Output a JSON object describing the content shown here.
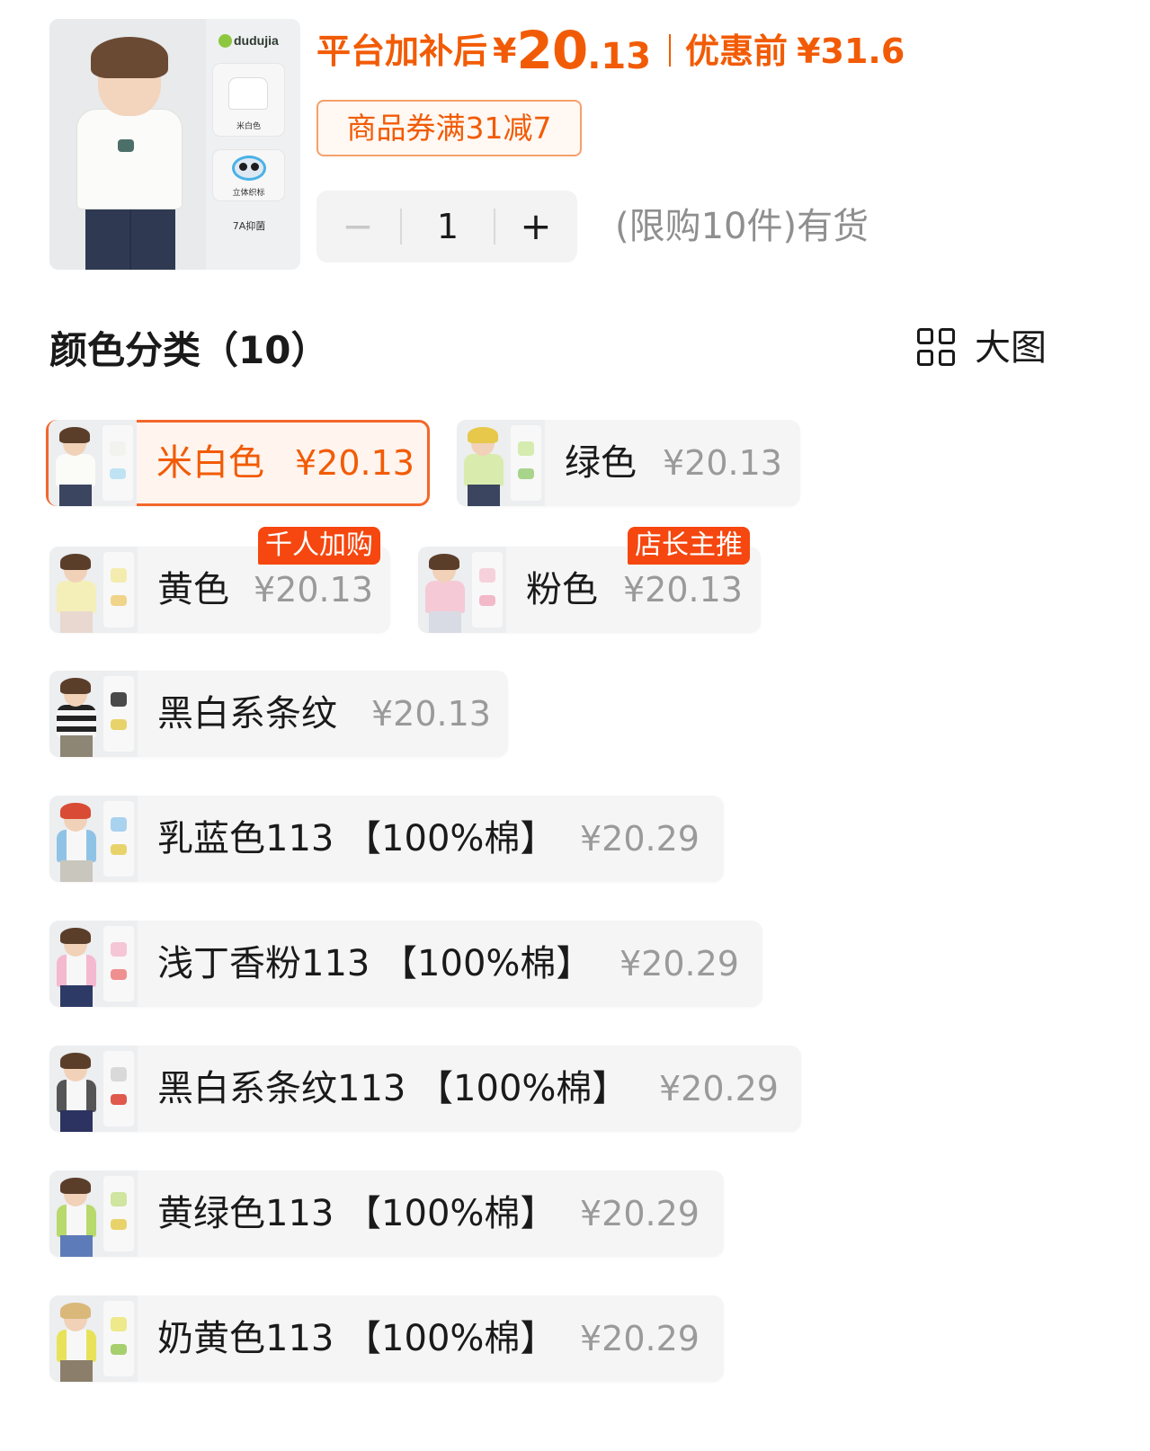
{
  "header": {
    "hero_brand": "dudujia",
    "hero_tile1_caption": "米白色",
    "hero_tile2_caption": "立体织标",
    "hero_tile3_caption": "7A抑菌",
    "price_label": "平台加补后",
    "price_yen": "¥",
    "price_int": "20",
    "price_dec": ".13",
    "orig_label": "优惠前",
    "orig_price": "¥31.6",
    "coupon": "商品券满31减7",
    "stepper": {
      "minus": "−",
      "qty": "1",
      "plus": "+"
    },
    "stock": "(限购10件)有货"
  },
  "section": {
    "title": "颜色分类（10）",
    "view_label": "大图"
  },
  "options": [
    {
      "name": "米白色",
      "price": "¥20.13",
      "selected": true,
      "tag": ""
    },
    {
      "name": "绿色",
      "price": "¥20.13",
      "selected": false,
      "tag": ""
    },
    {
      "name": "黄色",
      "price": "¥20.13",
      "selected": false,
      "tag": "千人加购"
    },
    {
      "name": "粉色",
      "price": "¥20.13",
      "selected": false,
      "tag": "店长主推"
    },
    {
      "name": "黑白系条纹",
      "price": "¥20.13",
      "selected": false,
      "tag": ""
    },
    {
      "name": "乳蓝色113 【100%棉】",
      "price": "¥20.29",
      "selected": false,
      "tag": ""
    },
    {
      "name": "浅丁香粉113 【100%棉】",
      "price": "¥20.29",
      "selected": false,
      "tag": ""
    },
    {
      "name": "黑白系条纹113 【100%棉】",
      "price": "¥20.29",
      "selected": false,
      "tag": ""
    },
    {
      "name": "黄绿色113 【100%棉】",
      "price": "¥20.29",
      "selected": false,
      "tag": ""
    },
    {
      "name": "奶黄色113 【100%棉】",
      "price": "¥20.29",
      "selected": false,
      "tag": ""
    }
  ],
  "colors": {
    "accent": "#f25b05",
    "tag_bg": "#f5470f",
    "selected_border": "#f3672a",
    "option_bg": "#f5f5f5",
    "muted_price": "#9a9a9a"
  }
}
